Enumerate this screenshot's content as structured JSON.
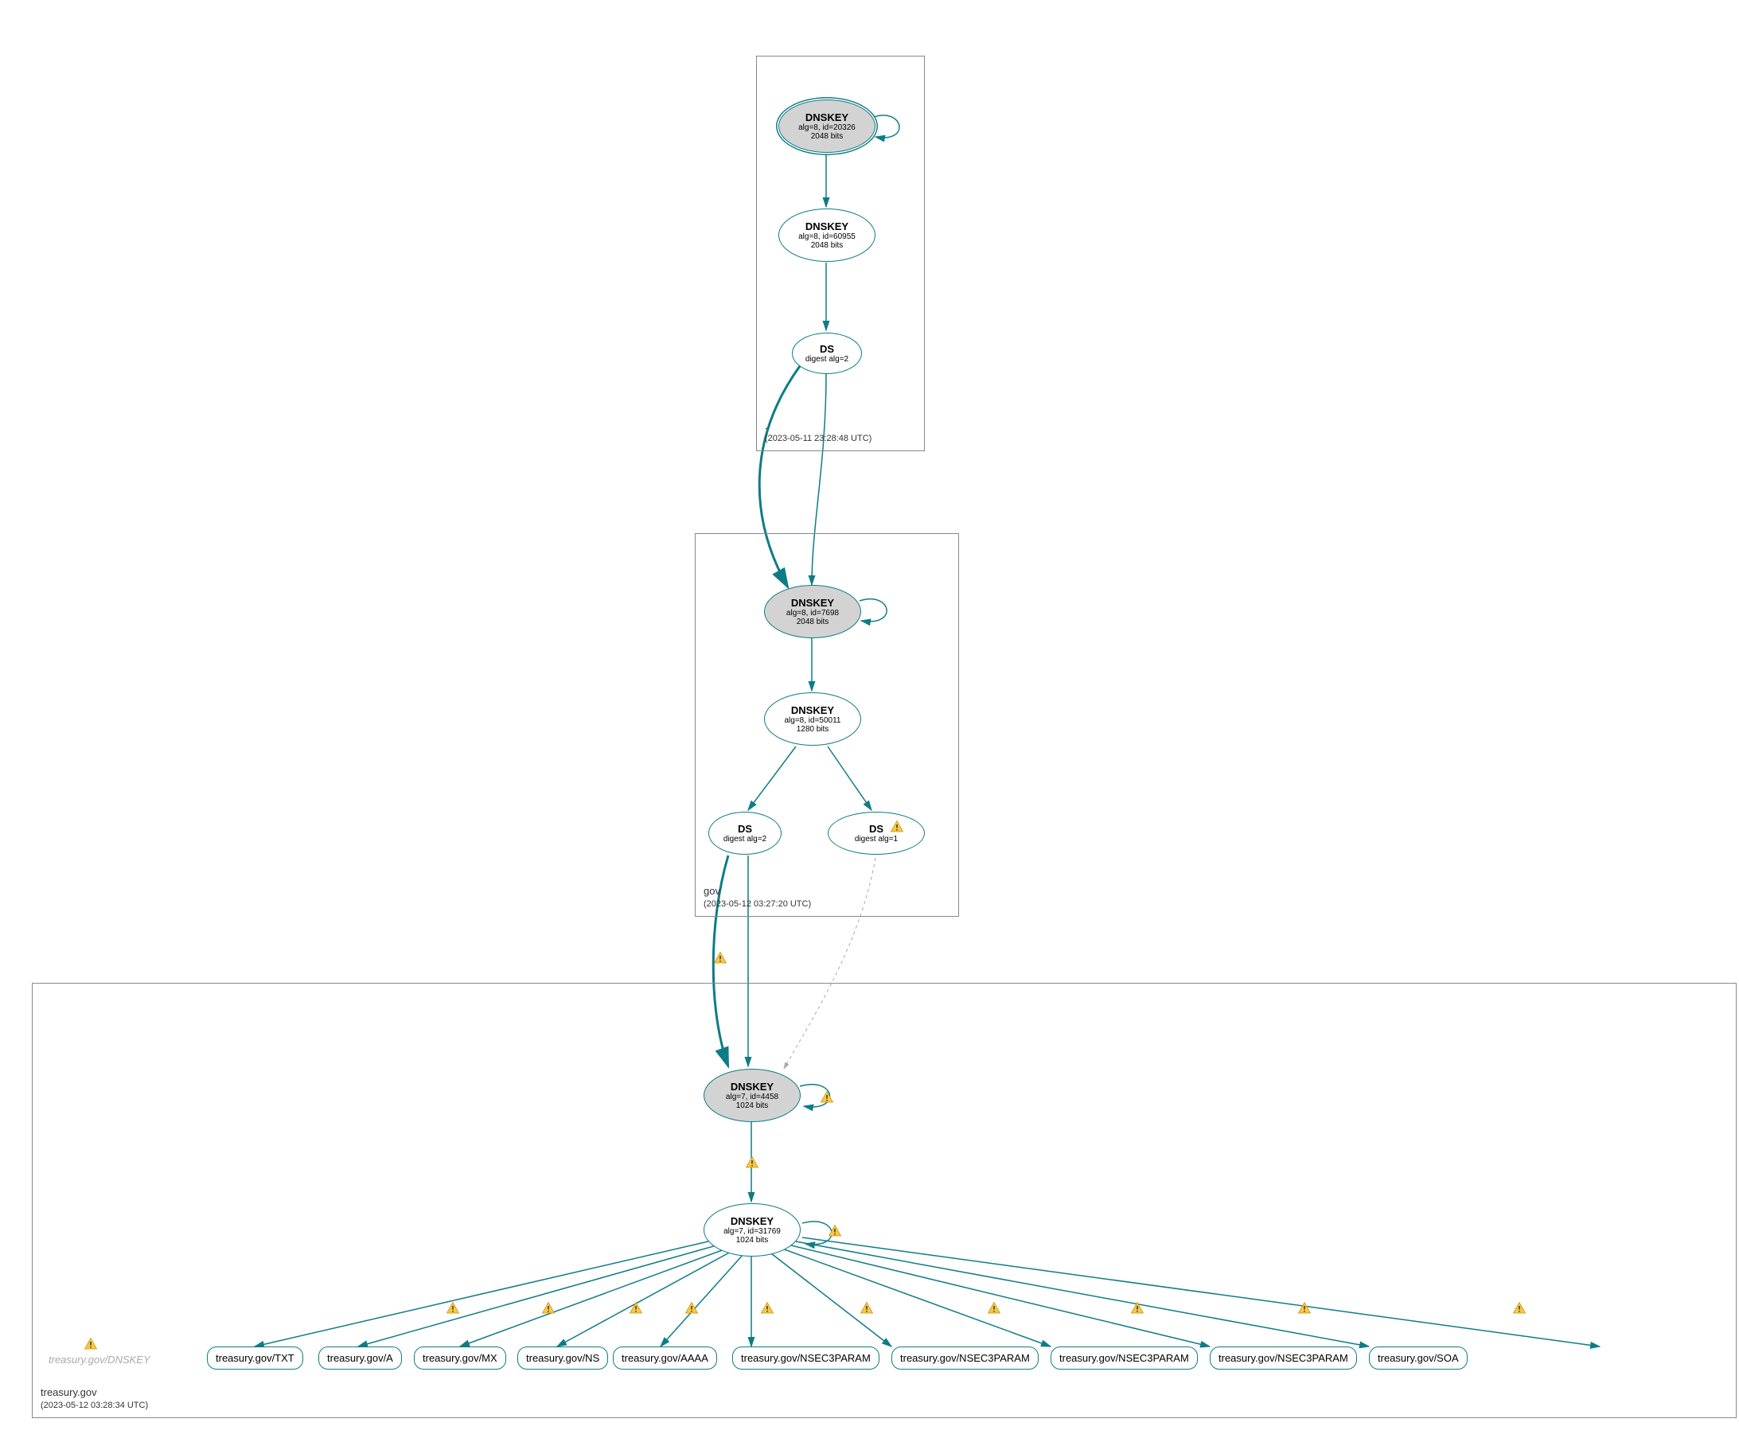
{
  "zones": {
    "root": {
      "name": ".",
      "timestamp": "(2023-05-11 23:28:48 UTC)"
    },
    "gov": {
      "name": "gov",
      "timestamp": "(2023-05-12 03:27:20 UTC)"
    },
    "treasury": {
      "name": "treasury.gov",
      "timestamp": "(2023-05-12 03:28:34 UTC)"
    },
    "treasury_faded": "treasury.gov/DNSKEY"
  },
  "nodes": {
    "root_ksk": {
      "title": "DNSKEY",
      "line2": "alg=8, id=20326",
      "line3": "2048 bits"
    },
    "root_zsk": {
      "title": "DNSKEY",
      "line2": "alg=8, id=60955",
      "line3": "2048 bits"
    },
    "root_ds": {
      "title": "DS",
      "line2": "digest alg=2"
    },
    "gov_ksk": {
      "title": "DNSKEY",
      "line2": "alg=8, id=7698",
      "line3": "2048 bits"
    },
    "gov_zsk": {
      "title": "DNSKEY",
      "line2": "alg=8, id=50011",
      "line3": "1280 bits"
    },
    "gov_ds1": {
      "title": "DS",
      "line2": "digest alg=2"
    },
    "gov_ds2": {
      "title": "DS",
      "line2": "digest alg=1"
    },
    "tr_ksk": {
      "title": "DNSKEY",
      "line2": "alg=7, id=4458",
      "line3": "1024 bits"
    },
    "tr_zsk": {
      "title": "DNSKEY",
      "line2": "alg=7, id=31769",
      "line3": "1024 bits"
    }
  },
  "rrsets": {
    "txt": "treasury.gov/TXT",
    "a": "treasury.gov/A",
    "mx": "treasury.gov/MX",
    "ns": "treasury.gov/NS",
    "aaaa": "treasury.gov/AAAA",
    "n3p1": "treasury.gov/NSEC3PARAM",
    "n3p2": "treasury.gov/NSEC3PARAM",
    "n3p3": "treasury.gov/NSEC3PARAM",
    "n3p4": "treasury.gov/NSEC3PARAM",
    "soa": "treasury.gov/SOA"
  },
  "colors": {
    "stroke": "#0e7c86",
    "fill_grey": "#d3d3d3"
  }
}
